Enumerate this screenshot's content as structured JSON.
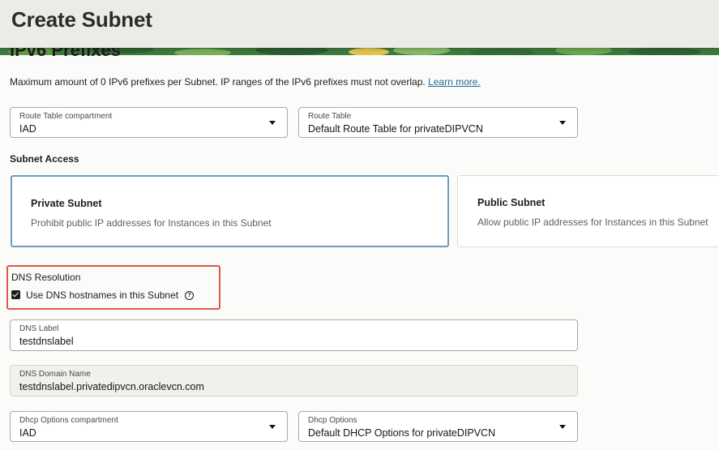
{
  "header": {
    "title": "Create Subnet"
  },
  "ipv6": {
    "section_title": "IPv6 Prefixes",
    "description": "Maximum amount of 0 IPv6 prefixes per Subnet. IP ranges of the IPv6 prefixes must not overlap.",
    "learn_more": "Learn more."
  },
  "route": {
    "compartment_label": "Route Table compartment",
    "compartment_value": "IAD",
    "table_label": "Route Table",
    "table_value": "Default Route Table for privateDIPVCN"
  },
  "subnet_access": {
    "label": "Subnet Access",
    "options": [
      {
        "title": "Private Subnet",
        "description": "Prohibit public IP addresses for Instances in this Subnet",
        "selected": true
      },
      {
        "title": "Public Subnet",
        "description": "Allow public IP addresses for Instances in this Subnet",
        "selected": false
      }
    ]
  },
  "dns": {
    "label": "DNS Resolution",
    "checkbox_label": "Use DNS hostnames in this Subnet",
    "checked": true,
    "help_icon": "question-circle-icon",
    "help_glyph": "?",
    "dns_label_label": "DNS Label",
    "dns_label_value": "testdnslabel",
    "domain_label": "DNS Domain Name",
    "domain_value": "testdnslabel.privatedipvcn.oraclevcn.com"
  },
  "dhcp": {
    "compartment_label": "Dhcp Options compartment",
    "compartment_value": "IAD",
    "options_label": "Dhcp Options",
    "options_value": "Default DHCP Options for privateDIPVCN"
  },
  "colors": {
    "header_bg": "#ecebe8",
    "link": "#246e9c",
    "selected_border": "#6d9dbd",
    "highlight": "#e2574b"
  }
}
